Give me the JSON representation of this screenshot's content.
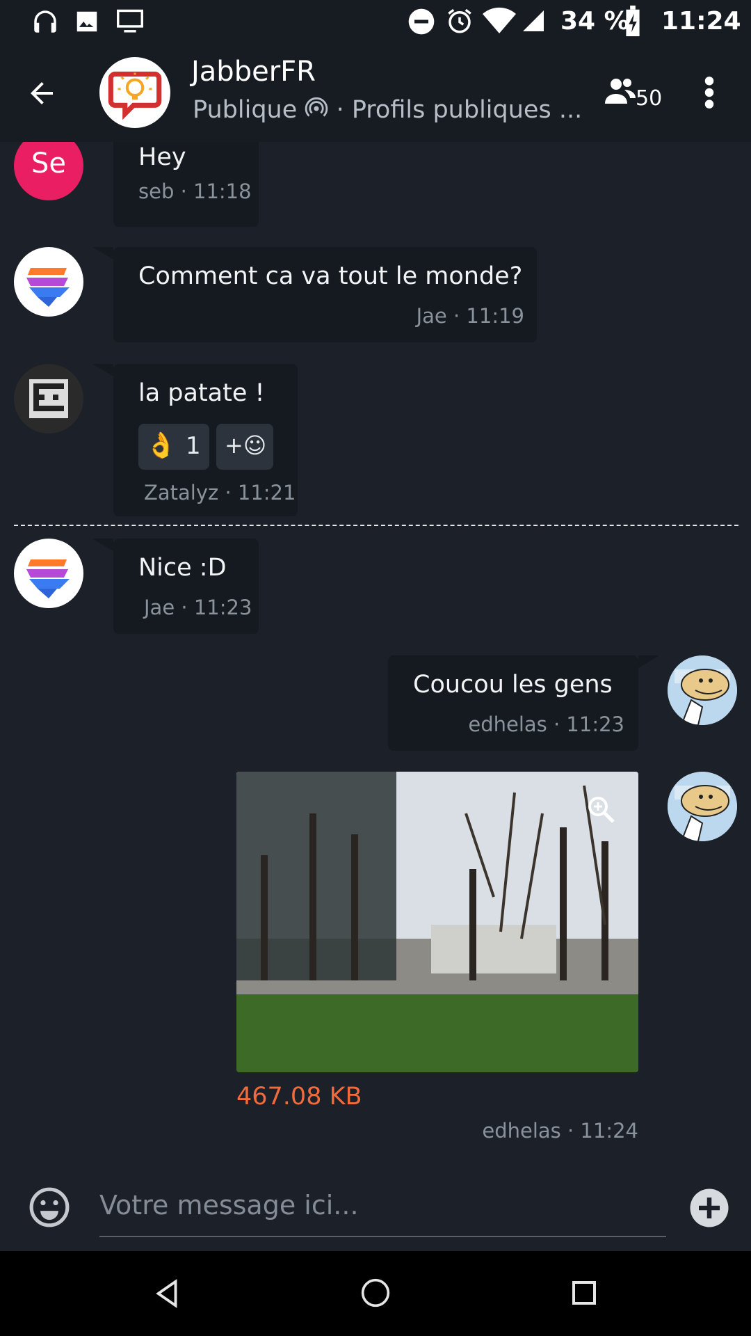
{
  "status_bar": {
    "battery": "34 %",
    "time": "11:24",
    "left_icons": [
      "headphones-icon",
      "image-icon",
      "monitor-icon"
    ],
    "right_icons": [
      "do-not-disturb-icon",
      "alarm-icon",
      "wifi-icon",
      "signal-icon",
      "battery-charging-icon"
    ]
  },
  "toolbar": {
    "title": "JabberFR",
    "subtitle_prefix": "Publique",
    "subtitle_suffix": "· Profils publiques ...",
    "participants": "50"
  },
  "messages": [
    {
      "author": "seb",
      "avatar_text": "Se",
      "text": "Hey",
      "meta": "seb · 11:18"
    },
    {
      "author": "Jae",
      "text": "Comment ca va tout le monde?",
      "meta": "Jae · 11:19"
    },
    {
      "author": "Zatalyz",
      "text": "la patate !",
      "reaction_emoji": "👌",
      "reaction_count": "1",
      "add_reaction": "+☺",
      "meta": "Zatalyz · 11:21"
    },
    {
      "author": "Jae",
      "text": "Nice :D",
      "meta": "Jae · 11:23"
    },
    {
      "author": "edhelas",
      "text": "Coucou les gens",
      "meta": "edhelas · 11:23"
    },
    {
      "author": "edhelas",
      "file_size": "467.08 KB",
      "meta": "edhelas · 11:24"
    }
  ],
  "composer": {
    "placeholder": "Votre message ici..."
  },
  "colors": {
    "background": "#1b2029",
    "bubble": "#151a21",
    "accent_file_size": "#f26b3a",
    "seb_avatar": "#e91e63"
  }
}
